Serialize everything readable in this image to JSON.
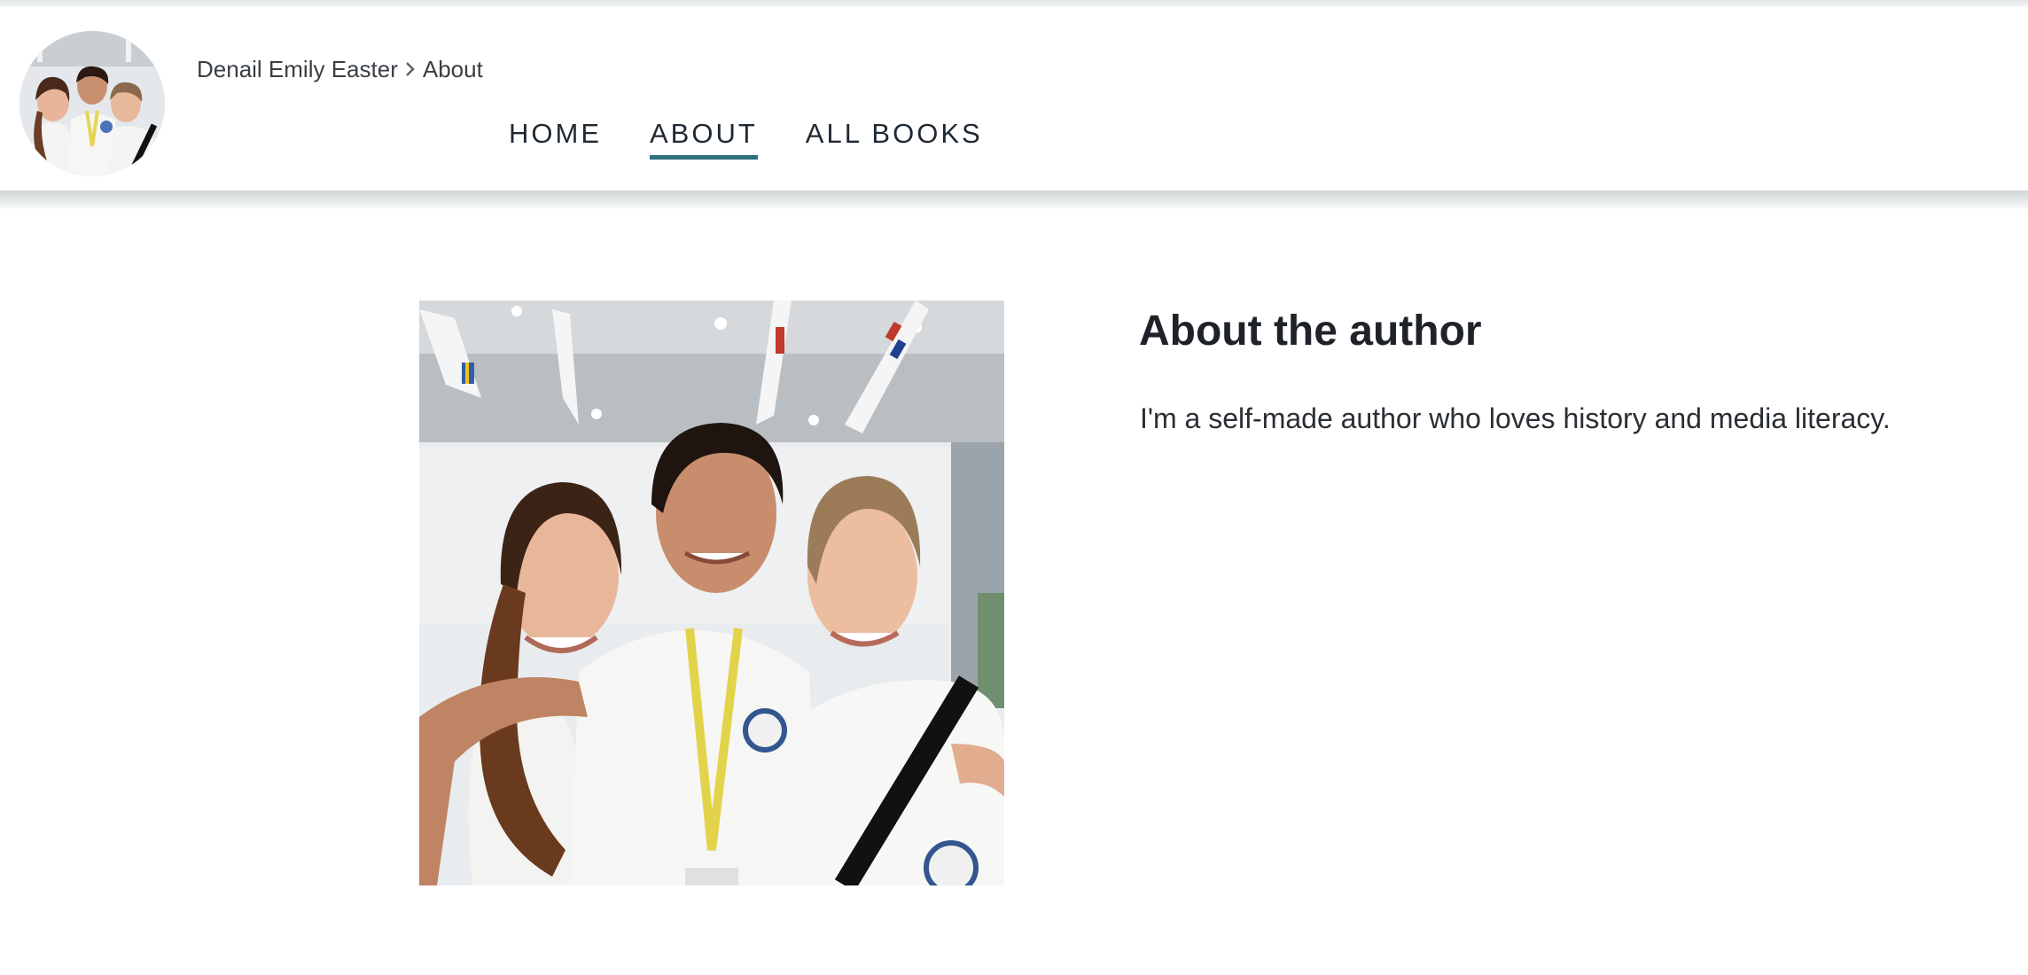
{
  "header": {
    "breadcrumb": {
      "author_name": "Denail Emily Easter",
      "current_page": "About"
    },
    "nav": [
      {
        "label": "HOME",
        "active": false
      },
      {
        "label": "ABOUT",
        "active": true
      },
      {
        "label": "ALL BOOKS",
        "active": false
      }
    ]
  },
  "main": {
    "about_title": "About the author",
    "about_bio": "I'm a self-made author who loves history and media literacy."
  },
  "colors": {
    "nav_active_underline": "#2f6f7e",
    "text": "#232f3e",
    "header_shadow": "#cfd6d6"
  },
  "icons": {
    "breadcrumb_separator": "chevron-right-icon"
  }
}
